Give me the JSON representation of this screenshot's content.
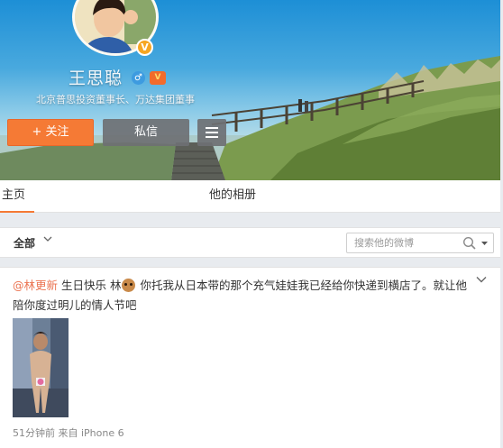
{
  "profile": {
    "name": "王思聪",
    "description": "北京普思投资董事长、万达集团董事",
    "verified_color": "#f6a623"
  },
  "actions": {
    "follow_label": "+ 关注",
    "message_label": "私信",
    "more_icon": "menu-icon"
  },
  "tabs": {
    "home": "主页",
    "album": "他的相册"
  },
  "filter": {
    "all_label": "全部",
    "search_placeholder": "搜索他的微博"
  },
  "post": {
    "mention": "@林更新",
    "text_before_emoji": " 生日快乐 林",
    "text_after_emoji": " 你托我从日本带的那个充气娃娃我已经给你快递到横店了。就让他陪你度过明儿的情人节吧",
    "meta": "51分钟前 来自 iPhone 6"
  },
  "colors": {
    "accent": "#f57a35",
    "mention": "#eb7350"
  }
}
